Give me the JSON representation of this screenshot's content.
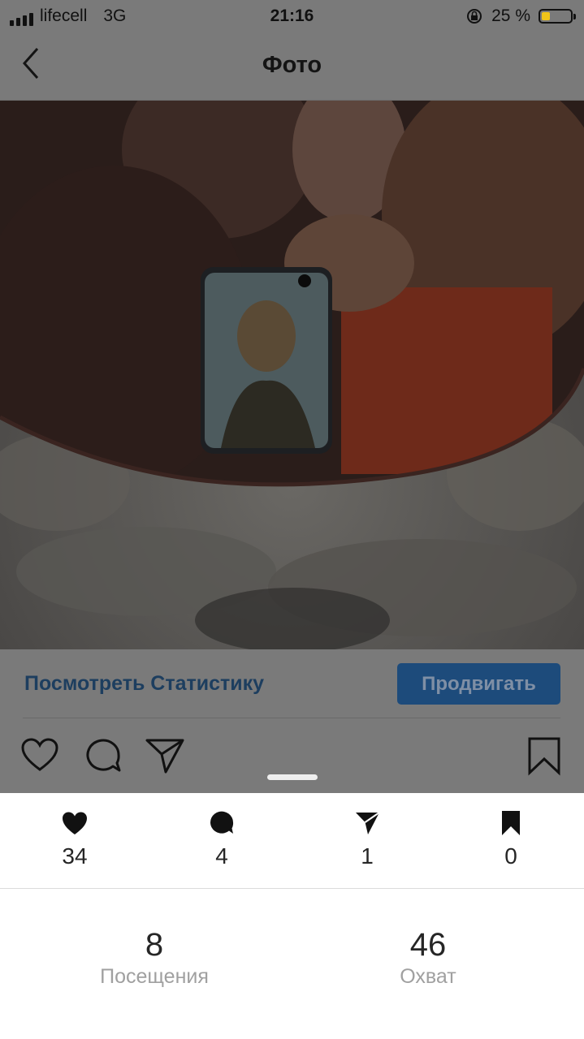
{
  "status_bar": {
    "carrier": "lifecell",
    "network": "3G",
    "time": "21:16",
    "battery_percent": "25 %",
    "battery_level": 0.25
  },
  "nav": {
    "title": "Фото",
    "back_icon": "chevron-left-icon"
  },
  "photo": {
    "content": "photo"
  },
  "post_actions": {
    "stats_link": "Посмотреть Статистику",
    "promote_button": "Продвигать",
    "icons": [
      "heart-icon",
      "comment-icon",
      "share-icon",
      "bookmark-icon"
    ]
  },
  "insights": {
    "interactions": [
      {
        "icon": "heart-filled-icon",
        "value": "34"
      },
      {
        "icon": "comment-filled-icon",
        "value": "4"
      },
      {
        "icon": "send-filled-icon",
        "value": "1"
      },
      {
        "icon": "bookmark-filled-icon",
        "value": "0"
      }
    ],
    "metrics": [
      {
        "value": "8",
        "label": "Посещения"
      },
      {
        "value": "46",
        "label": "Охват"
      }
    ]
  },
  "colors": {
    "overlay": "#7a7a7a",
    "accent_link": "#1d3e5f",
    "button_bg": "#1d4b7b",
    "text": "#262626",
    "muted": "#a0a0a0"
  }
}
